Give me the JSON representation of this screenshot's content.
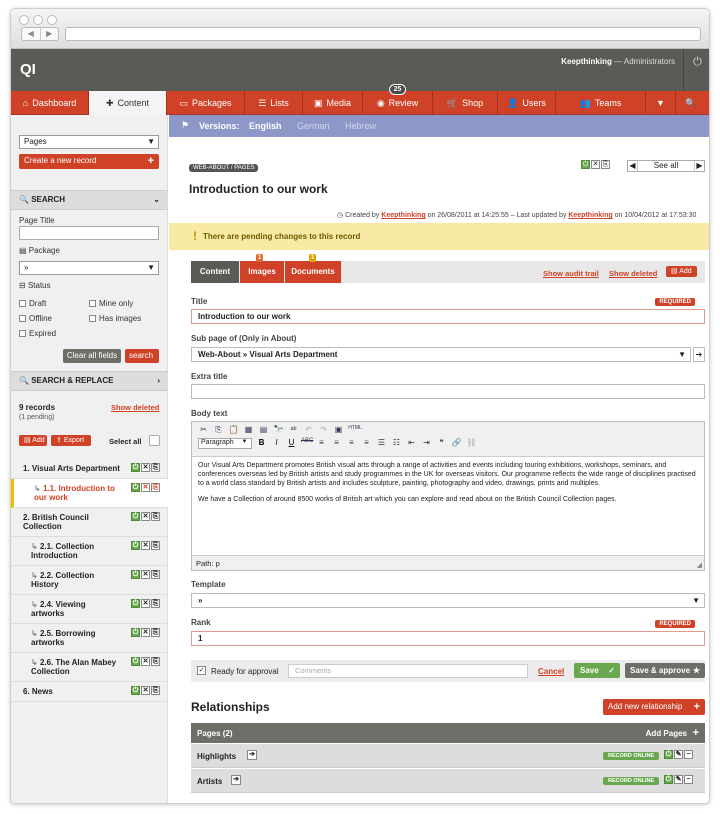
{
  "app": {
    "logo": "QI",
    "user_name": "Keepthinking",
    "user_role": "Administrators",
    "user_sep": " — "
  },
  "nav": [
    {
      "label": "Dashboard",
      "icon": "house-icon"
    },
    {
      "label": "Content",
      "icon": "plus-icon"
    },
    {
      "label": "Packages",
      "icon": "package-icon"
    },
    {
      "label": "Lists",
      "icon": "list-icon"
    },
    {
      "label": "Media",
      "icon": "media-icon"
    },
    {
      "label": "Review",
      "icon": "eye-icon",
      "badge": "25"
    },
    {
      "label": "Shop",
      "icon": "cart-icon"
    },
    {
      "label": "Users",
      "icon": "user-icon"
    },
    {
      "label": "Teams",
      "icon": "team-icon"
    }
  ],
  "sidebar": {
    "type_select": "Pages",
    "create_label": "Create a new record",
    "search_header": "SEARCH",
    "page_title_label": "Page Title",
    "package_label": "Package",
    "package_value": "»",
    "status_label": "Status",
    "status_opts": [
      "Draft",
      "Mine only",
      "Offline",
      "Has images",
      "Expired"
    ],
    "clear_label": "Clear all fields",
    "search_btn": "search",
    "replace_header": "SEARCH & REPLACE",
    "records_count": "9 records",
    "pending_count": "(1 pending)",
    "show_deleted": "Show deleted",
    "add_label": "Add",
    "export_label": "Export",
    "select_all": "Select all",
    "tree": [
      {
        "label": "1. Visual Arts Department",
        "child": false,
        "active": false
      },
      {
        "label": "1.1. Introduction to our work",
        "child": true,
        "active": true
      },
      {
        "label": "2. British Council Collection",
        "child": false,
        "active": false
      },
      {
        "label": "2.1. Collection Introduction",
        "child": true,
        "active": false
      },
      {
        "label": "2.2. Collection History",
        "child": true,
        "active": false
      },
      {
        "label": "2.4. Viewing artworks",
        "child": true,
        "active": false
      },
      {
        "label": "2.5. Borrowing artworks",
        "child": true,
        "active": false
      },
      {
        "label": "2.6. The Alan Mabey Collection",
        "child": true,
        "active": false
      },
      {
        "label": "6. News",
        "child": false,
        "active": false
      }
    ]
  },
  "versions": {
    "label": "Versions:",
    "langs": [
      "English",
      "German",
      "Hebrew"
    ]
  },
  "record": {
    "tag": "WEB-ABOUT / PAGES",
    "title": "Introduction to our work",
    "see_all": "See all",
    "created_prefix": "Created by",
    "created_by": "Keepthinking",
    "created_on": "on 26/08/2011 at 14:25:55 – Last updated by",
    "updated_by": "Keepthinking",
    "updated_on": "on 10/04/2012 at 17:53:30",
    "pending_msg": "There are pending changes to this record"
  },
  "tabs": [
    {
      "label": "Content"
    },
    {
      "label": "Images",
      "badge": "1"
    },
    {
      "label": "Documents",
      "badge": "1"
    }
  ],
  "tab_links": {
    "audit": "Show audit trail",
    "deleted": "Show deleted",
    "add": "Add"
  },
  "form": {
    "title_label": "Title",
    "required": "REQUIRED",
    "title_value": "Introduction to our work",
    "subpage_label": "Sub page of (Only in About)",
    "subpage_value": "Web-About » Visual Arts Department",
    "extra_label": "Extra title",
    "body_label": "Body text",
    "paragraph": "Paragraph",
    "body_p1": "Our Visual Arts Department promotes British visual arts through a range of activities and events including touring exhibitions, workshops, seminars, and conferences overseas led by British artists and study programmes in the UK for overseas visitors. Our programme reflects the wide range of disciplines practised to a world class standard by British artists and includes sculpture, painting, photography and video, drawings, prints and multiples.",
    "body_p2": "We have a Collection of around 8500 works of British art which you can explore and read about on the British Council Collection pages.",
    "path": "Path: p",
    "template_label": "Template",
    "template_value": "»",
    "rank_label": "Rank",
    "rank_value": "1",
    "ready": "Ready for approval",
    "comments_ph": "Comments",
    "cancel": "Cancel",
    "save": "Save",
    "save_approve": "Save & approve"
  },
  "relationships": {
    "title": "Relationships",
    "add_new": "Add new relationship",
    "pages_header": "Pages (2)",
    "add_pages": "Add Pages",
    "rows": [
      {
        "label": "Highlights",
        "status": "RECORD ONLINE"
      },
      {
        "label": "Artists",
        "status": "RECORD ONLINE"
      }
    ]
  }
}
